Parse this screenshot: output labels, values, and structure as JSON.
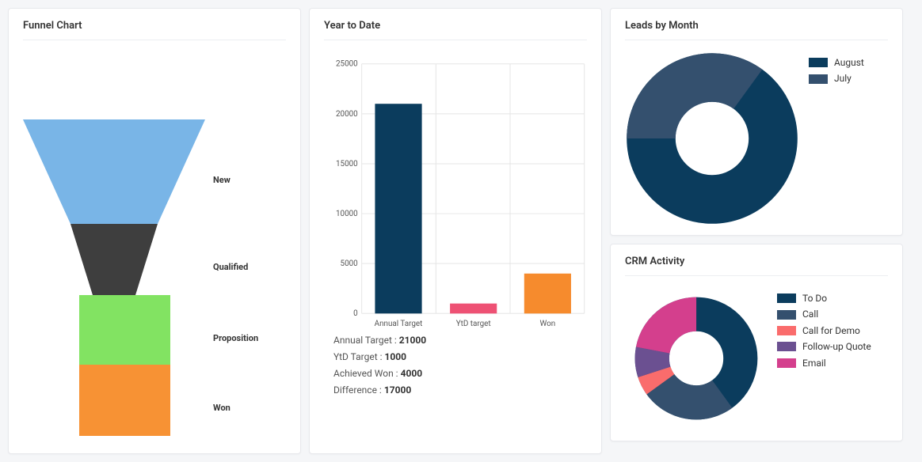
{
  "funnel": {
    "title": "Funnel Chart",
    "labels": {
      "new": "New",
      "qualified": "Qualified",
      "proposition": "Proposition",
      "won": "Won"
    }
  },
  "ytd": {
    "title": "Year to Date",
    "stats": {
      "annual_target_label": "Annual Target :",
      "annual_target_value": "21000",
      "ytd_target_label": "YtD Target :",
      "ytd_target_value": "1000",
      "achieved_label": "Achieved Won :",
      "achieved_value": "4000",
      "diff_label": "Difference :",
      "diff_value": "17000"
    },
    "bar_labels": {
      "annual": "Annual Target",
      "ytd": "YtD target",
      "won": "Won"
    },
    "tick_labels": {
      "t0": "0",
      "t5000": "5000",
      "t10000": "10000",
      "t15000": "15000",
      "t20000": "20000",
      "t25000": "25000"
    }
  },
  "leads": {
    "title": "Leads by Month",
    "legend": {
      "august": "August",
      "july": "July"
    }
  },
  "crm": {
    "title": "CRM Activity",
    "legend": {
      "todo": "To Do",
      "call": "Call",
      "demo": "Call for Demo",
      "followup": "Follow-up Quote",
      "email": "Email"
    }
  },
  "colors": {
    "navy": "#0b3c5d",
    "slate": "#34506e",
    "green": "#7fd96b",
    "orange": "#f68b2d",
    "charcoal": "#3e3e3e",
    "blue": "#79b5e7",
    "midblue": "#2f528f",
    "pink": "#d8437a",
    "coral": "#fa6c6c",
    "lilac": "#6b5091",
    "magenta": "#d43f8d"
  },
  "chart_data": [
    {
      "type": "bar",
      "title": "Year to Date",
      "categories": [
        "Annual Target",
        "YtD target",
        "Won"
      ],
      "values": [
        21000,
        1000,
        4000
      ],
      "ylim": [
        0,
        25000
      ],
      "ylabel": "",
      "xlabel": ""
    },
    {
      "type": "pie",
      "title": "Leads by Month",
      "series": [
        {
          "name": "August",
          "value": 65
        },
        {
          "name": "July",
          "value": 35
        }
      ],
      "note": "approximate proportions read from chart",
      "donut": true
    },
    {
      "type": "pie",
      "title": "CRM Activity",
      "series": [
        {
          "name": "To Do",
          "value": 40
        },
        {
          "name": "Call",
          "value": 25
        },
        {
          "name": "Call for Demo",
          "value": 5
        },
        {
          "name": "Follow-up Quote",
          "value": 8
        },
        {
          "name": "Email",
          "value": 22
        }
      ],
      "note": "approximate proportions read from chart",
      "donut": true
    },
    {
      "type": "bar",
      "title": "Funnel Chart",
      "categories": [
        "New",
        "Qualified",
        "Proposition",
        "Won"
      ],
      "values": [
        100,
        60,
        40,
        40
      ],
      "note": "funnel stage relative widths, no numeric axis shown",
      "subtype": "funnel"
    }
  ]
}
